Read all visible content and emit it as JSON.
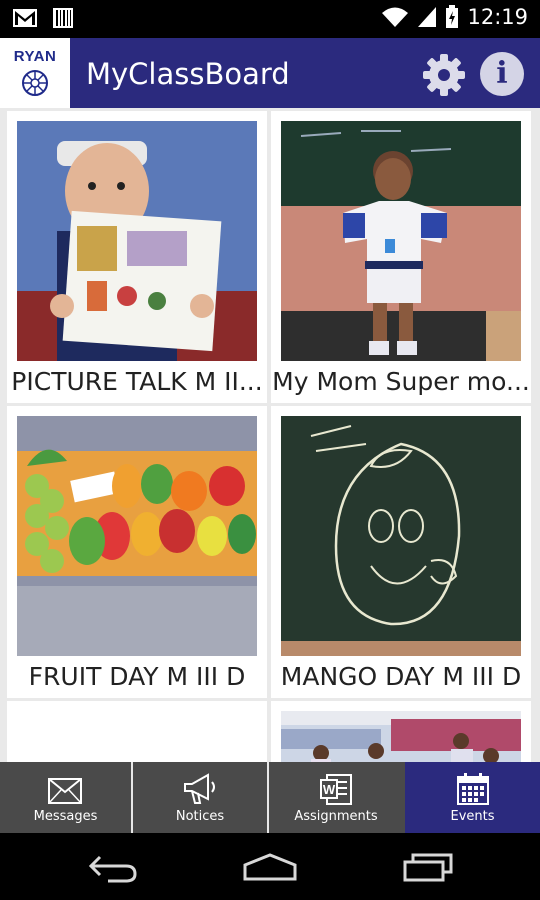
{
  "status_bar": {
    "time": "12:19"
  },
  "app_bar": {
    "logo_text": "RYAN",
    "title": "MyClassBoard",
    "info_glyph": "i",
    "accent": "#2b2a7e"
  },
  "events": [
    {
      "title": "PICTURE TALK M II..."
    },
    {
      "title": "My Mom Super mo..."
    },
    {
      "title": "FRUIT DAY M III D"
    },
    {
      "title": "MANGO DAY M III D"
    },
    {
      "title": ""
    },
    {
      "title": ""
    }
  ],
  "tabs": [
    {
      "label": "Messages",
      "icon": "envelope-icon",
      "active": false
    },
    {
      "label": "Notices",
      "icon": "megaphone-icon",
      "active": false
    },
    {
      "label": "Assignments",
      "icon": "word-document-icon",
      "active": false
    },
    {
      "label": "Events",
      "icon": "calendar-icon",
      "active": true
    }
  ]
}
